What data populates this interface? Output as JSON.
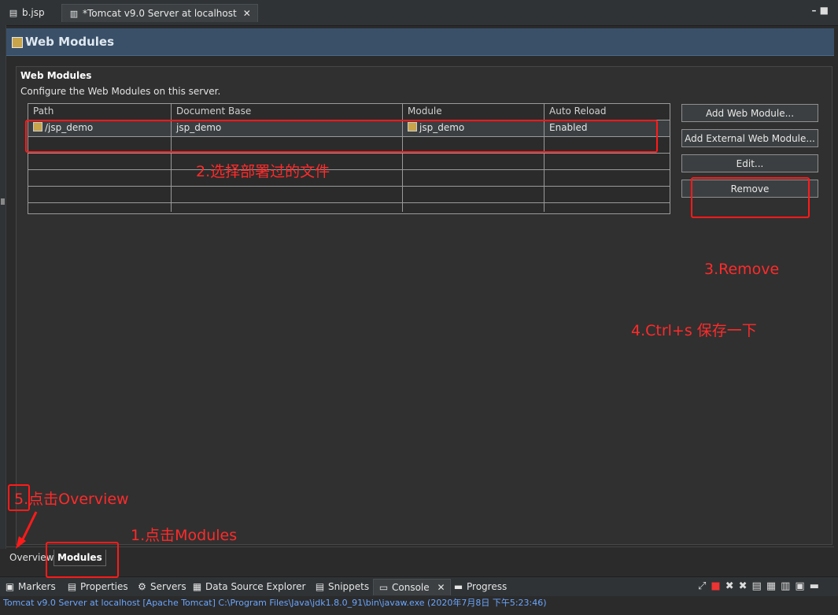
{
  "editor_tabs": [
    {
      "label": "b.jsp",
      "icon": "jsp-file-icon"
    },
    {
      "label": "*Tomcat v9.0 Server at localhost",
      "icon": "server-config-icon",
      "close": "✕"
    }
  ],
  "window_controls": "– ■",
  "header": {
    "title": "Web Modules"
  },
  "section": {
    "title": "Web Modules",
    "description": "Configure the Web Modules on this server."
  },
  "table": {
    "columns": [
      "Path",
      "Document Base",
      "Module",
      "Auto Reload"
    ],
    "rows": [
      {
        "path": "/jsp_demo",
        "document_base": "jsp_demo",
        "module": "jsp_demo",
        "auto_reload": "Enabled"
      }
    ]
  },
  "buttons": {
    "add": "Add Web Module...",
    "add_external": "Add External Web Module...",
    "edit": "Edit...",
    "remove": "Remove"
  },
  "page_tabs": [
    "Overview",
    "Modules"
  ],
  "views": [
    "Markers",
    "Properties",
    "Servers",
    "Data Source Explorer",
    "Snippets",
    "Console",
    "Progress"
  ],
  "console_close": "✕",
  "console_status": "Tomcat v9.0 Server at localhost [Apache Tomcat] C:\\Program Files\\Java\\jdk1.8.0_91\\bin\\javaw.exe (2020年7月8日 下午5:23:46)",
  "annotations": {
    "step1": "1.点击Modules",
    "step2": "2.选择部署过的文件",
    "step3": "3.Remove",
    "step4": "4.Ctrl+s 保存一下",
    "step5": "5.点击Overview"
  },
  "colors": {
    "annotation": "#ff2a2a",
    "header_bg": "#3a5068",
    "status_text": "#6aa6ff"
  }
}
